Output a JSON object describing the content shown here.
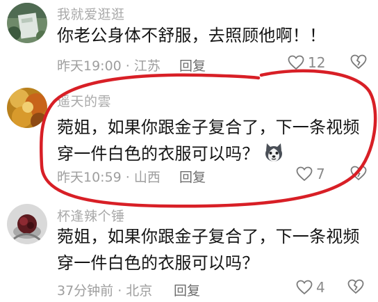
{
  "comments": [
    {
      "username": "我就爱逛逛",
      "text_lines": [
        "你老公身体不舒服，去照顾他啊！！"
      ],
      "meta": "昨天19:00 · 江苏",
      "reply_label": "回复",
      "like_count": "12"
    },
    {
      "username": "遥天的雲",
      "text_lines": [
        "菀姐，如果你跟金子复合了，下一条视频",
        "穿一件白色的衣服可以吗？"
      ],
      "meta": "昨天10:59 · 山西",
      "reply_label": "回复",
      "like_count": "7",
      "emoji_icon": "husky-dog-emoji-icon"
    },
    {
      "username": "杯逢辣个锤",
      "text_lines": [
        "菀姐，如果你跟金子复合了，下一条视频",
        "穿一件白色的衣服可以吗？"
      ],
      "meta": "37分钟前 · 北京",
      "reply_label": "回复",
      "like_count": "4"
    }
  ],
  "icons": {
    "like": "heart-outline-icon",
    "dislike": "broken-heart-icon"
  },
  "colors": {
    "annotation_ink": "#d81f26",
    "username": "#a9a9a9",
    "meta": "#9e9e9e"
  }
}
